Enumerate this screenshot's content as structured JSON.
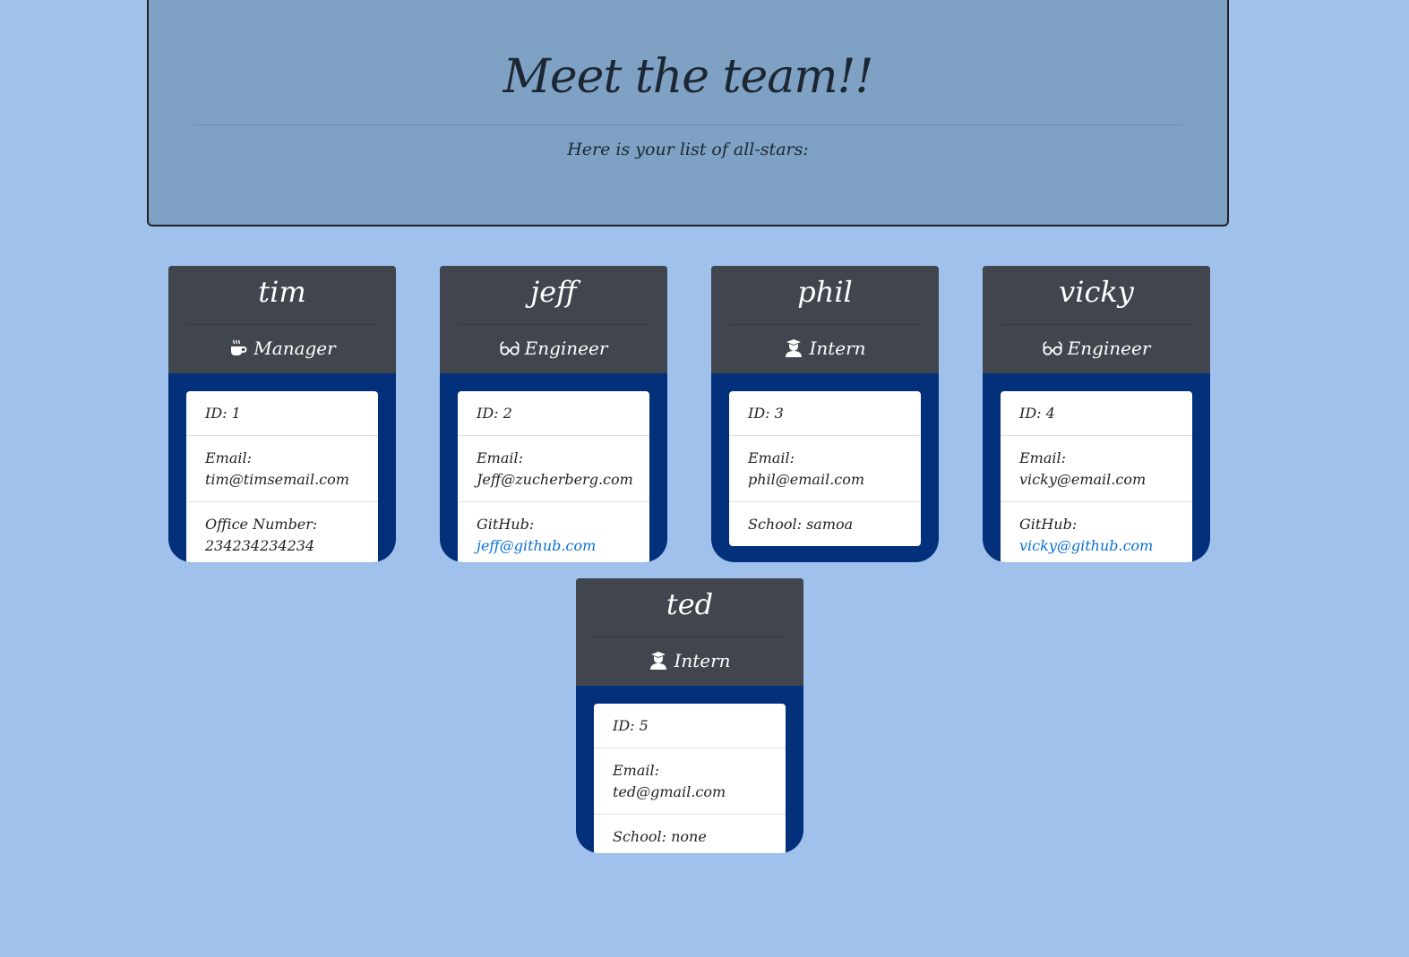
{
  "header": {
    "title": "Meet the team!!",
    "subtitle": "Here is your list of all-stars:"
  },
  "colors": {
    "background": "#9fc1eb",
    "jumbotron": "#7ea1c4",
    "card_header": "#40454e",
    "card_body": "#03307a",
    "link": "#0a6fd8"
  },
  "team": [
    {
      "name": "tim",
      "role": "Manager",
      "role_icon": "coffee-icon",
      "id": "ID: 1",
      "email_label": "Email: ",
      "email": "tim@timsemail.com",
      "extra_label": "Office Number: ",
      "extra": "234234234234"
    },
    {
      "name": "jeff",
      "role": "Engineer",
      "role_icon": "glasses-icon",
      "id": "ID: 2",
      "email_label": "Email: ",
      "email": "Jeff@zucherberg.com",
      "extra_label": "GitHub: ",
      "extra": "jeff@github.com"
    },
    {
      "name": "phil",
      "role": "Intern",
      "role_icon": "graduate-icon",
      "id": "ID: 3",
      "email_label": "Email: ",
      "email": "phil@email.com",
      "extra_label": "School: ",
      "extra": "samoa"
    },
    {
      "name": "vicky",
      "role": "Engineer",
      "role_icon": "glasses-icon",
      "id": "ID: 4",
      "email_label": "Email: ",
      "email": "vicky@email.com",
      "extra_label": "GitHub: ",
      "extra": "vicky@github.com"
    },
    {
      "name": "ted",
      "role": "Intern",
      "role_icon": "graduate-icon",
      "id": "ID: 5",
      "email_label": "Email: ",
      "email": "ted@gmail.com",
      "extra_label": "School: ",
      "extra": "none"
    }
  ]
}
